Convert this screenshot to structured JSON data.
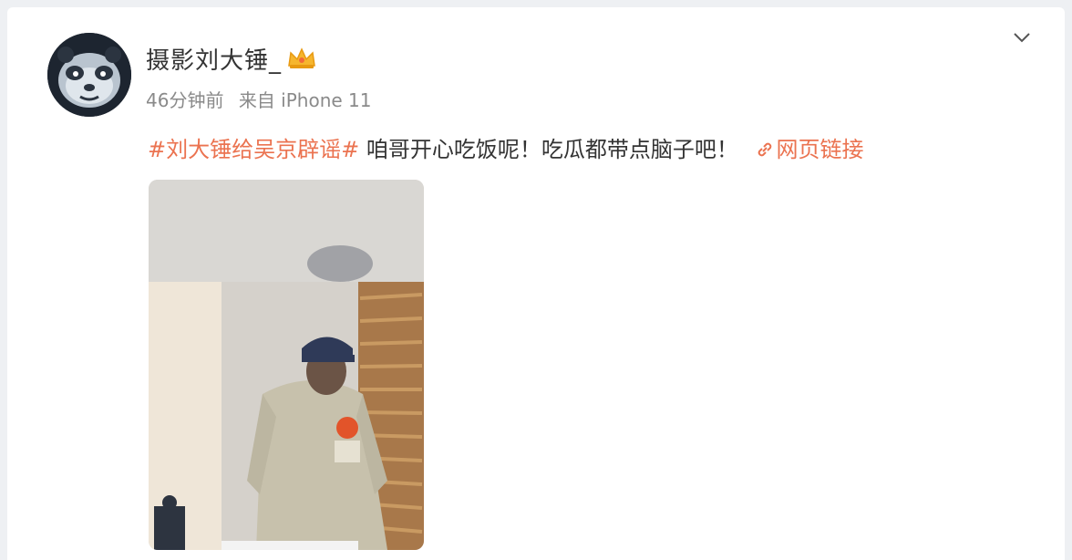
{
  "post": {
    "author": "摄影刘大锤_",
    "time": "46分钟前",
    "source": "来自 iPhone 11",
    "hashtag": "#刘大锤给吴京辟谣#",
    "body": "咱哥开心吃饭呢！吃瓜都带点脑子吧！",
    "link_label": "网页链接"
  },
  "icons": {
    "avatar": "panda-avatar",
    "badge": "crown-badge-icon",
    "menu": "chevron-down-icon",
    "link": "link-icon"
  },
  "colors": {
    "accent": "#eb7350",
    "text": "#333333",
    "meta": "#8a8a8a"
  }
}
